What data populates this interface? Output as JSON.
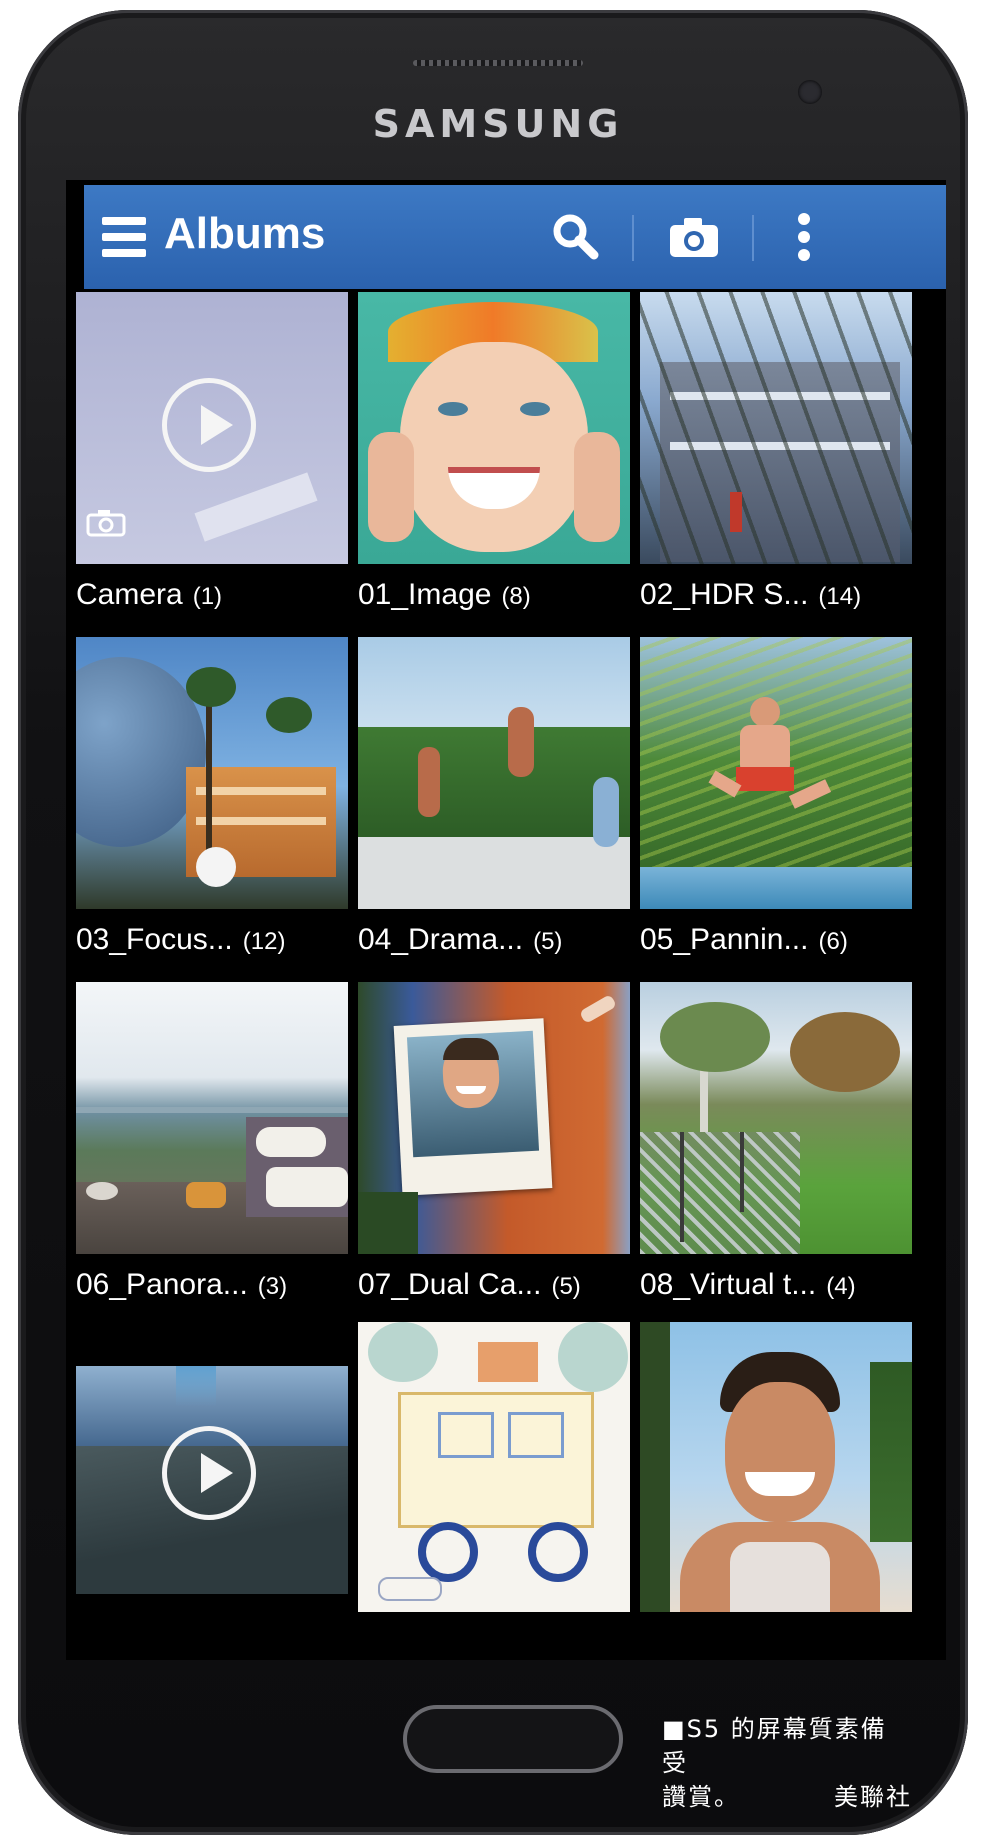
{
  "device": {
    "brand": "SAMSUNG"
  },
  "actionbar": {
    "title": "Albums",
    "icons": [
      "menu-icon",
      "search-icon",
      "camera-icon",
      "overflow-menu-icon"
    ],
    "color": "#2f66b0"
  },
  "albums": [
    {
      "name": "Camera",
      "count": "(1)",
      "thumb": "video",
      "colors": [
        "#b9bcd6",
        "#c7cae0"
      ]
    },
    {
      "name": "01_Image",
      "count": "(8)",
      "thumb": "face",
      "colors": [
        "#3fb3a0",
        "#f4c9a8"
      ]
    },
    {
      "name": "02_HDR S...",
      "count": "(14)",
      "thumb": "building",
      "colors": [
        "#8aa9cf",
        "#3a4a5e"
      ]
    },
    {
      "name": "03_Focus...",
      "count": "(12)",
      "thumb": "globe",
      "colors": [
        "#5d8bc2",
        "#c98a3a"
      ]
    },
    {
      "name": "04_Drama...",
      "count": "(5)",
      "thumb": "jump",
      "colors": [
        "#9fc3e2",
        "#3d6f34"
      ]
    },
    {
      "name": "05_Pannin...",
      "count": "(6)",
      "thumb": "panning",
      "colors": [
        "#4e8a3a",
        "#a8c84a"
      ]
    },
    {
      "name": "06_Panora...",
      "count": "(3)",
      "thumb": "terrace",
      "colors": [
        "#e8eef2",
        "#5b7a5a"
      ]
    },
    {
      "name": "07_Dual Ca...",
      "count": "(5)",
      "thumb": "door",
      "colors": [
        "#c45a2a",
        "#e9e4d6"
      ]
    },
    {
      "name": "08_Virtual t...",
      "count": "(4)",
      "thumb": "park",
      "colors": [
        "#5aa33c",
        "#9fc0d8"
      ]
    },
    {
      "name": "",
      "count": "",
      "thumb": "video",
      "colors": [
        "#2d4a6e",
        "#8fb0cf"
      ]
    },
    {
      "name": "",
      "count": "",
      "thumb": "drawing",
      "colors": [
        "#f4f2ee",
        "#4a6fae"
      ]
    },
    {
      "name": "",
      "count": "",
      "thumb": "selfie",
      "colors": [
        "#8ec1e6",
        "#c98a64"
      ]
    }
  ],
  "caption": {
    "line1": "■S5 的屏幕質素備受",
    "line2": "讚賞。",
    "credit": "美聯社"
  }
}
